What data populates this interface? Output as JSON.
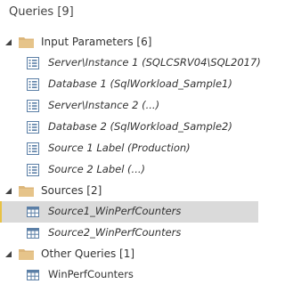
{
  "pane": {
    "title": "Queries [9]"
  },
  "groups": [
    {
      "label": "Input Parameters [6]",
      "items": [
        {
          "label": "Server\\Instance 1 (SQLCSRV04\\SQL2017)",
          "icon": "parameter-icon"
        },
        {
          "label": "Database 1 (SqlWorkload_Sample1)",
          "icon": "parameter-icon"
        },
        {
          "label": "Server\\Instance 2 (...)",
          "icon": "parameter-icon"
        },
        {
          "label": "Database 2 (SqlWorkload_Sample2)",
          "icon": "parameter-icon"
        },
        {
          "label": "Source 1 Label (Production)",
          "icon": "parameter-icon"
        },
        {
          "label": "Source 2 Label (...)",
          "icon": "parameter-icon"
        }
      ]
    },
    {
      "label": "Sources [2]",
      "items": [
        {
          "label": "Source1_WinPerfCounters",
          "icon": "table-icon",
          "selected": true
        },
        {
          "label": "Source2_WinPerfCounters",
          "icon": "table-icon"
        }
      ]
    },
    {
      "label": "Other Queries [1]",
      "items": [
        {
          "label": "WinPerfCounters",
          "icon": "table-icon"
        }
      ]
    }
  ],
  "colors": {
    "folder": "#dcb67a",
    "selection_bg": "#dadada",
    "selection_accent": "#e8c245",
    "icon_blue": "#5b7fa6"
  }
}
